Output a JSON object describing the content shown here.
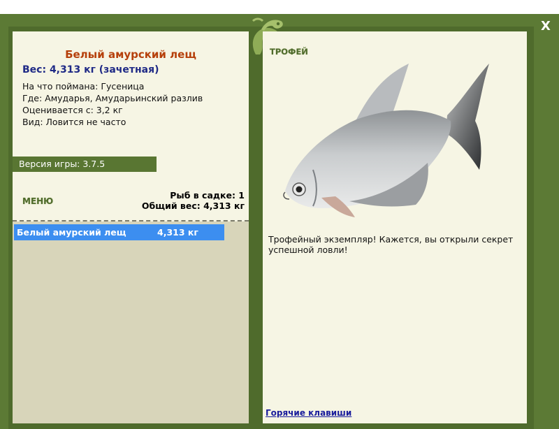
{
  "window": {
    "close_label": "X"
  },
  "fish": {
    "title": "Белый амурский лещ",
    "weight": "Вес: 4,313 кг (зачетная)",
    "bait": "На что поймана: Гусеница",
    "location": "Где: Амударья, Амударьинский разлив",
    "rated_from": "Оценивается с: 3,2 кг",
    "kind": "Вид: Ловится не часто"
  },
  "version": "Версия игры: 3.7.5",
  "menu_label": "МЕНЮ",
  "keepnet": {
    "count": "Рыб в садке: 1",
    "total": "Общий вес: 4,313 кг"
  },
  "catch_list": [
    {
      "name": "Белый амурский лещ",
      "weight": "4,313 кг"
    }
  ],
  "trophy": {
    "label": "ТРОФЕЙ",
    "text": "Трофейный экземпляр! Кажется, вы открыли секрет успешной ловли!"
  },
  "hotkeys_label": "Горячие клавиши",
  "colors": {
    "frame": "#5c7a35",
    "panel": "#f6f5e4",
    "list_bg": "#d8d5ba",
    "selected_row": "#3c8ef0",
    "title": "#b6400b",
    "weight": "#1f2a86"
  }
}
